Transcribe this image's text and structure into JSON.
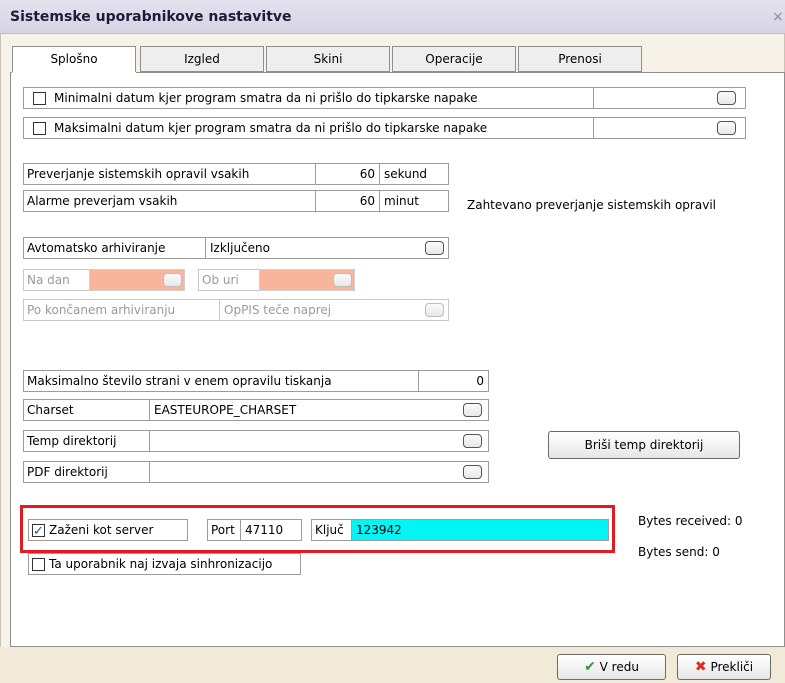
{
  "window": {
    "title": "Sistemske uporabnikove nastavitve",
    "close_glyph": "×"
  },
  "tabs": [
    {
      "label": "Splošno",
      "active": true
    },
    {
      "label": "Izgled",
      "active": false
    },
    {
      "label": "Skini",
      "active": false
    },
    {
      "label": "Operacije",
      "active": false
    },
    {
      "label": "Prenosi",
      "active": false
    }
  ],
  "typo": {
    "min_label": "Minimalni datum kjer program smatra da ni prišlo do tipkarske napake",
    "max_label": "Maksimalni datum kjer program smatra da ni prišlo do tipkarske napake",
    "min_value": "",
    "max_value": ""
  },
  "checks": {
    "label": "Preverjanje sistemskih opravil vsakih",
    "value": "60",
    "unit": "sekund"
  },
  "alarms": {
    "label": "Alarme preverjam vsakih",
    "value": "60",
    "unit": "minut"
  },
  "system_tasks_request": "Zahtevano preverjanje sistemskih opravil",
  "archiving": {
    "label": "Avtomatsko arhiviranje",
    "value": "Izključeno",
    "day_label": "Na dan",
    "time_label": "Ob uri",
    "after_label": "Po končanem arhiviranju",
    "after_value": "OpPIS teče naprej"
  },
  "print": {
    "max_pages_label": "Maksimalno število strani v enem opravilu tiskanja",
    "max_pages_value": "0"
  },
  "charset": {
    "label": "Charset",
    "value": "EASTEUROPE_CHARSET"
  },
  "temp_dir": {
    "label": "Temp direktorij",
    "value": ""
  },
  "pdf_dir": {
    "label": "PDF direktorij",
    "value": ""
  },
  "clear_temp_button": "Briši temp direktorij",
  "server": {
    "run_as_server_label": "Zaženi kot server",
    "run_as_server_checked": true,
    "port_label": "Port",
    "port_value": "47110",
    "key_label": "Ključ",
    "key_value": "123942",
    "key_bg": "#00f5f5"
  },
  "sync": {
    "label": "Ta uporabnik naj izvaja sinhronizacijo",
    "checked": false
  },
  "stats": {
    "received": "Bytes received: 0",
    "sent": "Bytes send: 0"
  },
  "buttons": {
    "ok": "V redu",
    "cancel": "Prekliči"
  },
  "colors": {
    "highlight_box": "#e01b24",
    "pink_field": "#f9b59c"
  }
}
